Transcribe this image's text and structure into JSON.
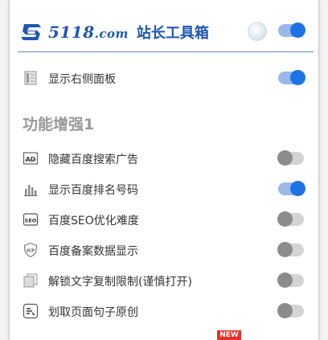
{
  "header": {
    "brand_number": "5118",
    "brand_domain": ".com",
    "title": "站长工具箱",
    "master_toggle_on": true
  },
  "rows_top": [
    {
      "label": "显示右侧面板",
      "icon": "side-panel-icon",
      "on": true
    }
  ],
  "section": {
    "title": "功能增强1"
  },
  "rows": [
    {
      "label": "隐藏百度搜索广告",
      "icon": "ad-icon",
      "on": false
    },
    {
      "label": "显示百度排名号码",
      "icon": "rank-bars-icon",
      "on": true
    },
    {
      "label": "百度SEO优化难度",
      "icon": "seo-icon",
      "on": false
    },
    {
      "label": "百度备案数据显示",
      "icon": "icp-shield-icon",
      "on": false
    },
    {
      "label": "解锁文字复制限制(谨慎打开)",
      "icon": "copy-icon",
      "on": false
    },
    {
      "label": "划取页面句子原创",
      "icon": "original-icon",
      "on": false
    }
  ],
  "badge": {
    "label": "NEW"
  },
  "colors": {
    "brand": "#1d57b4",
    "toggle_on": "#1d73e6",
    "toggle_off": "#8c8c8c"
  }
}
